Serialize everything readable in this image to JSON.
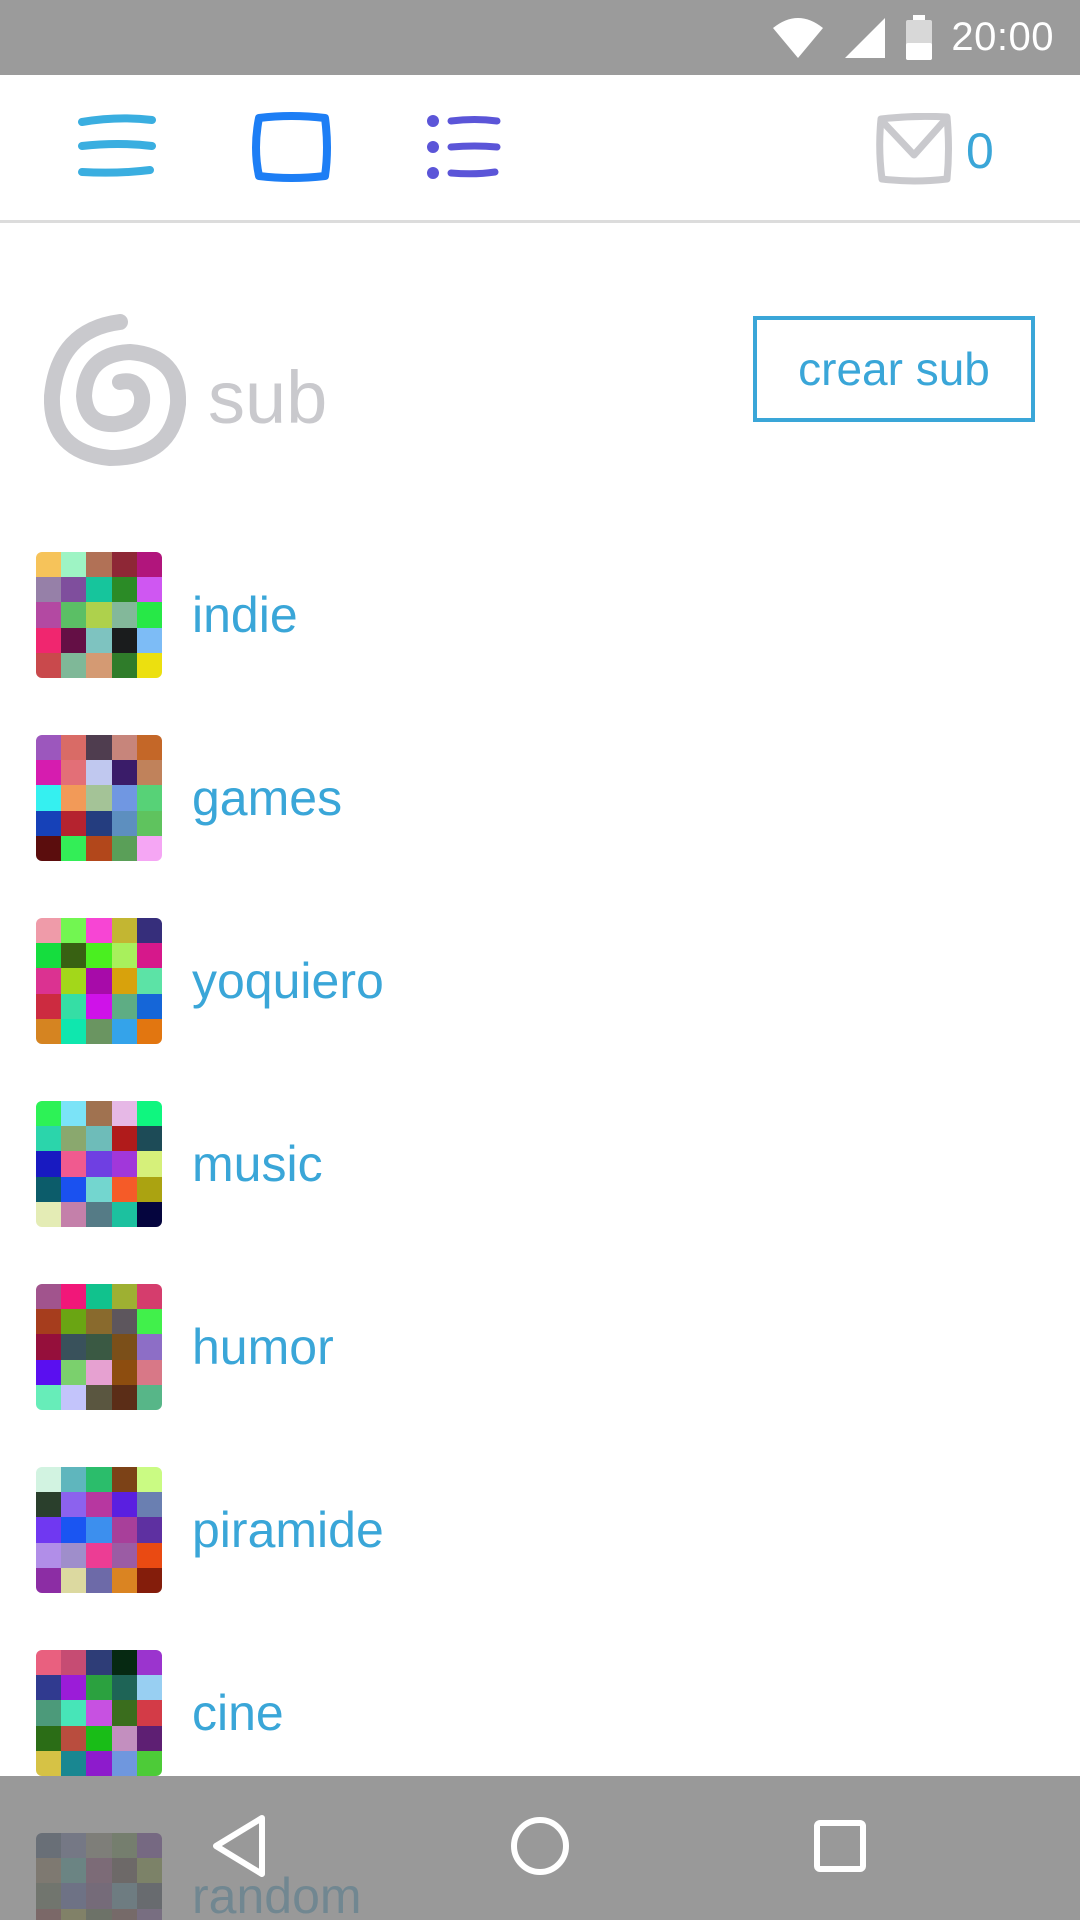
{
  "status_bar": {
    "time": "20:00",
    "icons": [
      "wifi-icon",
      "cell-signal-icon",
      "battery-icon"
    ]
  },
  "toolbar": {
    "menu_icon": "hamburger-menu-icon",
    "single_view_icon": "square-view-icon",
    "list_view_icon": "list-view-icon",
    "mail_icon": "envelope-icon",
    "mail_count": "0"
  },
  "header": {
    "logo_icon": "spiral-logo-icon",
    "logo_text": "sub",
    "create_button_label": "crear sub"
  },
  "colors": {
    "accent": "#3aa6d8",
    "menu_icon": "#3aaee0",
    "single_view_icon": "#1d7ef5",
    "list_icon": "#5b55d8",
    "muted": "#c9c9cd",
    "bars": "#9b9b9b"
  },
  "subs": [
    {
      "label": "indie",
      "colors": [
        "#f6c35a",
        "#9ef4c4",
        "#b17156",
        "#8e2736",
        "#b1157c",
        "#9680a8",
        "#7f4e9d",
        "#16c59c",
        "#2b8b26",
        "#cf57f2",
        "#b349a2",
        "#5bbf65",
        "#aed14c",
        "#83b89a",
        "#27e847",
        "#f0266f",
        "#640f45",
        "#7ec3c0",
        "#1a1c1d",
        "#7dbcf6",
        "#c9494c",
        "#7fb898",
        "#d49a73",
        "#2f7c2a",
        "#ece00f"
      ]
    },
    {
      "label": "games",
      "colors": [
        "#9c57bd",
        "#d96b66",
        "#4f3d4f",
        "#c7857b",
        "#c46728",
        "#d61caf",
        "#e36f77",
        "#c0c8ef",
        "#3a1c69",
        "#c0825b",
        "#35f0f0",
        "#f29a58",
        "#a4c397",
        "#7097e2",
        "#57d277",
        "#1641b8",
        "#b5232f",
        "#243d7f",
        "#5d8fbf",
        "#5fc35e",
        "#5b0d0d",
        "#33ee57",
        "#b2471b",
        "#5a9f58",
        "#f5a6f4"
      ]
    },
    {
      "label": "yoquiero",
      "colors": [
        "#ef9ba9",
        "#72f651",
        "#f745d4",
        "#c3b632",
        "#362e7b",
        "#15dd3e",
        "#386112",
        "#4aef20",
        "#a8f05c",
        "#d6188b",
        "#db3291",
        "#a3d71a",
        "#a70ba9",
        "#d8a20c",
        "#5ce3a6",
        "#cc2b40",
        "#35dea5",
        "#cf12e9",
        "#5ead84",
        "#1566d8",
        "#d58421",
        "#0fe7ae",
        "#6a9561",
        "#34a3ea",
        "#e27610"
      ]
    },
    {
      "label": "music",
      "colors": [
        "#2df256",
        "#7be3f7",
        "#a07250",
        "#e6b8e6",
        "#0ff67f",
        "#2bd5ab",
        "#8aa86e",
        "#6ebcb9",
        "#b01b1b",
        "#1d4b57",
        "#181ac1",
        "#f05a8f",
        "#6f3fe2",
        "#a137da",
        "#d6f07a",
        "#0c5c6a",
        "#1a51f0",
        "#73d6cf",
        "#f55b28",
        "#aba311",
        "#e4ecb5",
        "#c480aa",
        "#557b86",
        "#1cc19f",
        "#05053e"
      ]
    },
    {
      "label": "humor",
      "colors": [
        "#a1548d",
        "#f11779",
        "#11c28d",
        "#9eb032",
        "#d53d6d",
        "#a63d1d",
        "#6aa513",
        "#896a2d",
        "#5d565d",
        "#41f04b",
        "#950f3b",
        "#39515b",
        "#3a5943",
        "#7b4f19",
        "#8d6ec6",
        "#5a0ff0",
        "#7bd06d",
        "#e6a1d1",
        "#8d4d0f",
        "#d87887",
        "#67edb9",
        "#c3c4fb",
        "#5a5640",
        "#5b2d17",
        "#57b688"
      ]
    },
    {
      "label": "piramide",
      "colors": [
        "#d2f3e1",
        "#5fb6bd",
        "#2bbd6b",
        "#7c4217",
        "#cafb83",
        "#2a3f2c",
        "#8c62ee",
        "#b737a0",
        "#5a1fe0",
        "#6a7fb1",
        "#7038f1",
        "#1a55f2",
        "#3c8fee",
        "#a83f9a",
        "#5e30a1",
        "#b18ee8",
        "#9f8ecb",
        "#ec3d94",
        "#9b5ca4",
        "#ea4a12",
        "#8c2da4",
        "#dcd9a0",
        "#6d6aa8",
        "#da8422",
        "#841d0b"
      ]
    },
    {
      "label": "cine",
      "colors": [
        "#e9607f",
        "#c64c73",
        "#2e3d77",
        "#062912",
        "#9b34ce",
        "#303a8f",
        "#9b1cd8",
        "#2ba13f",
        "#1e6456",
        "#98cff2",
        "#4c9a7a",
        "#47e5b8",
        "#c751e1",
        "#3a6d1d",
        "#d33b47",
        "#2b6d16",
        "#b94d3e",
        "#19bd17",
        "#c38fbf",
        "#5e1f73",
        "#d6c245",
        "#198791",
        "#8d1bcc",
        "#6f97de",
        "#4dcb38"
      ]
    },
    {
      "label": "random",
      "colors": [
        "#122f58",
        "#4d5a9b",
        "#7a7761",
        "#4b7a2c",
        "#4f0f8d",
        "#7b5e3b",
        "#1a9690",
        "#6d1b56",
        "#27110d",
        "#6f8b0e",
        "#3a4c2a",
        "#2a3c9a",
        "#4a1b5f",
        "#2b6d89",
        "#0a1a31",
        "#6a0c0c",
        "#88860d",
        "#233f0d",
        "#50160f",
        "#5c2a89",
        "#3a250d",
        "#1a0d3e",
        "#2a0f2b",
        "#1c6a23",
        "#8b1a3b"
      ]
    }
  ],
  "nav_bar": {
    "back_icon": "back-triangle-icon",
    "home_icon": "home-circle-icon",
    "recents_icon": "recents-square-icon"
  }
}
